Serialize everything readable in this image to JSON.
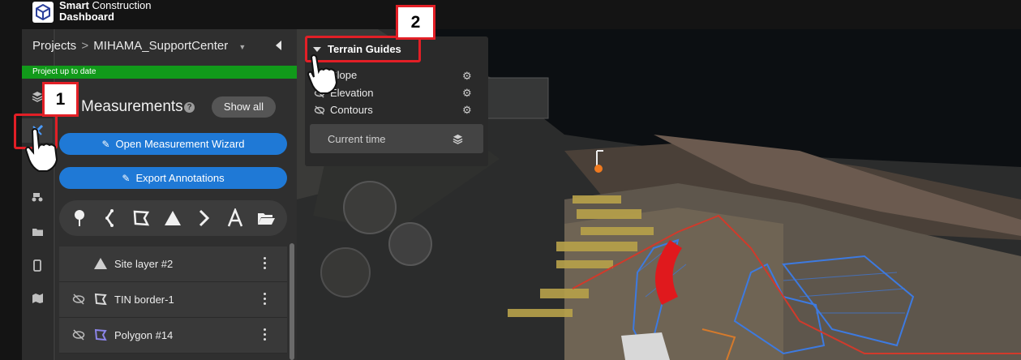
{
  "app": {
    "brand_line1_bold": "Smart",
    "brand_line1_rest": " Construction",
    "brand_line2": "Dashboard"
  },
  "breadcrumb": {
    "root": "Projects",
    "separator": ">",
    "project": "MIHAMA_SupportCenter"
  },
  "status": {
    "text": "Project up to date",
    "color": "#119a1a"
  },
  "rail": {
    "items": [
      {
        "name": "layers-icon"
      },
      {
        "name": "measure-icon",
        "active": true
      },
      {
        "name": "machines-icon"
      },
      {
        "name": "folder-icon"
      },
      {
        "name": "mobile-icon"
      },
      {
        "name": "map-icon"
      }
    ]
  },
  "measurements": {
    "title": "Measurements",
    "show_all": "Show all",
    "wizard_button": "Open Measurement Wizard",
    "export_button": "Export Annotations",
    "tools": [
      "point-tool-icon",
      "polyline-tool-icon",
      "polygon-tool-icon",
      "terrain-tool-icon",
      "arrow-tool-icon",
      "text-tool-icon",
      "folder-open-icon"
    ],
    "rows": [
      {
        "label": "Site layer #2",
        "icon": "triangle-icon",
        "visible": true
      },
      {
        "label": "TIN border-1",
        "icon": "polygon-icon",
        "visible": false
      },
      {
        "label": "Polygon #14",
        "icon": "polygon-icon",
        "visible": false
      }
    ]
  },
  "terrain_popup": {
    "header": "Terrain Guides",
    "items": [
      "Slope",
      "Elevation",
      "Contours"
    ],
    "current_time": "Current time"
  },
  "callouts": {
    "one": "1",
    "two": "2"
  },
  "colors": {
    "accent": "#1f79d6",
    "highlight": "#e21f26"
  }
}
